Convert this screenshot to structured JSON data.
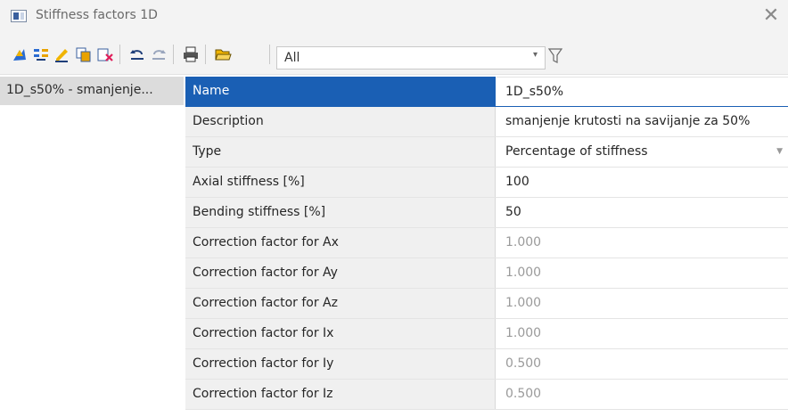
{
  "window": {
    "title": "Stiffness factors 1D",
    "close_glyph": "✕"
  },
  "toolbar": {
    "buttons": [
      {
        "name": "new-icon"
      },
      {
        "name": "insert-icon"
      },
      {
        "name": "edit-icon"
      },
      {
        "name": "copy-icon"
      },
      {
        "name": "delete-icon"
      },
      {
        "name": "undo-icon"
      },
      {
        "name": "redo-icon"
      },
      {
        "name": "print-icon"
      },
      {
        "name": "open-folder-icon"
      }
    ],
    "filter": {
      "selected": "All",
      "arrow": "▾"
    },
    "filter_icon": "funnel-icon"
  },
  "list": {
    "items": [
      "1D_s50% - smanjenje..."
    ]
  },
  "properties": [
    {
      "label": "Name",
      "value": "1D_s50%"
    },
    {
      "label": "Description",
      "value": "smanjenje krutosti na savijanje za 50%"
    },
    {
      "label": "Type",
      "value": "Percentage of stiffness"
    },
    {
      "label": "Axial stiffness [%]",
      "value": "100"
    },
    {
      "label": "Bending stiffness [%]",
      "value": "50"
    },
    {
      "label": "Correction factor for Ax",
      "value": "1.000"
    },
    {
      "label": "Correction factor for Ay",
      "value": "1.000"
    },
    {
      "label": "Correction factor for Az",
      "value": "1.000"
    },
    {
      "label": "Correction factor for Ix",
      "value": "1.000"
    },
    {
      "label": "Correction factor for Iy",
      "value": "0.500"
    },
    {
      "label": "Correction factor for Iz",
      "value": "0.500"
    }
  ],
  "colors": {
    "selection": "#1a5fb4",
    "muted_value": "#9a9a9a"
  }
}
